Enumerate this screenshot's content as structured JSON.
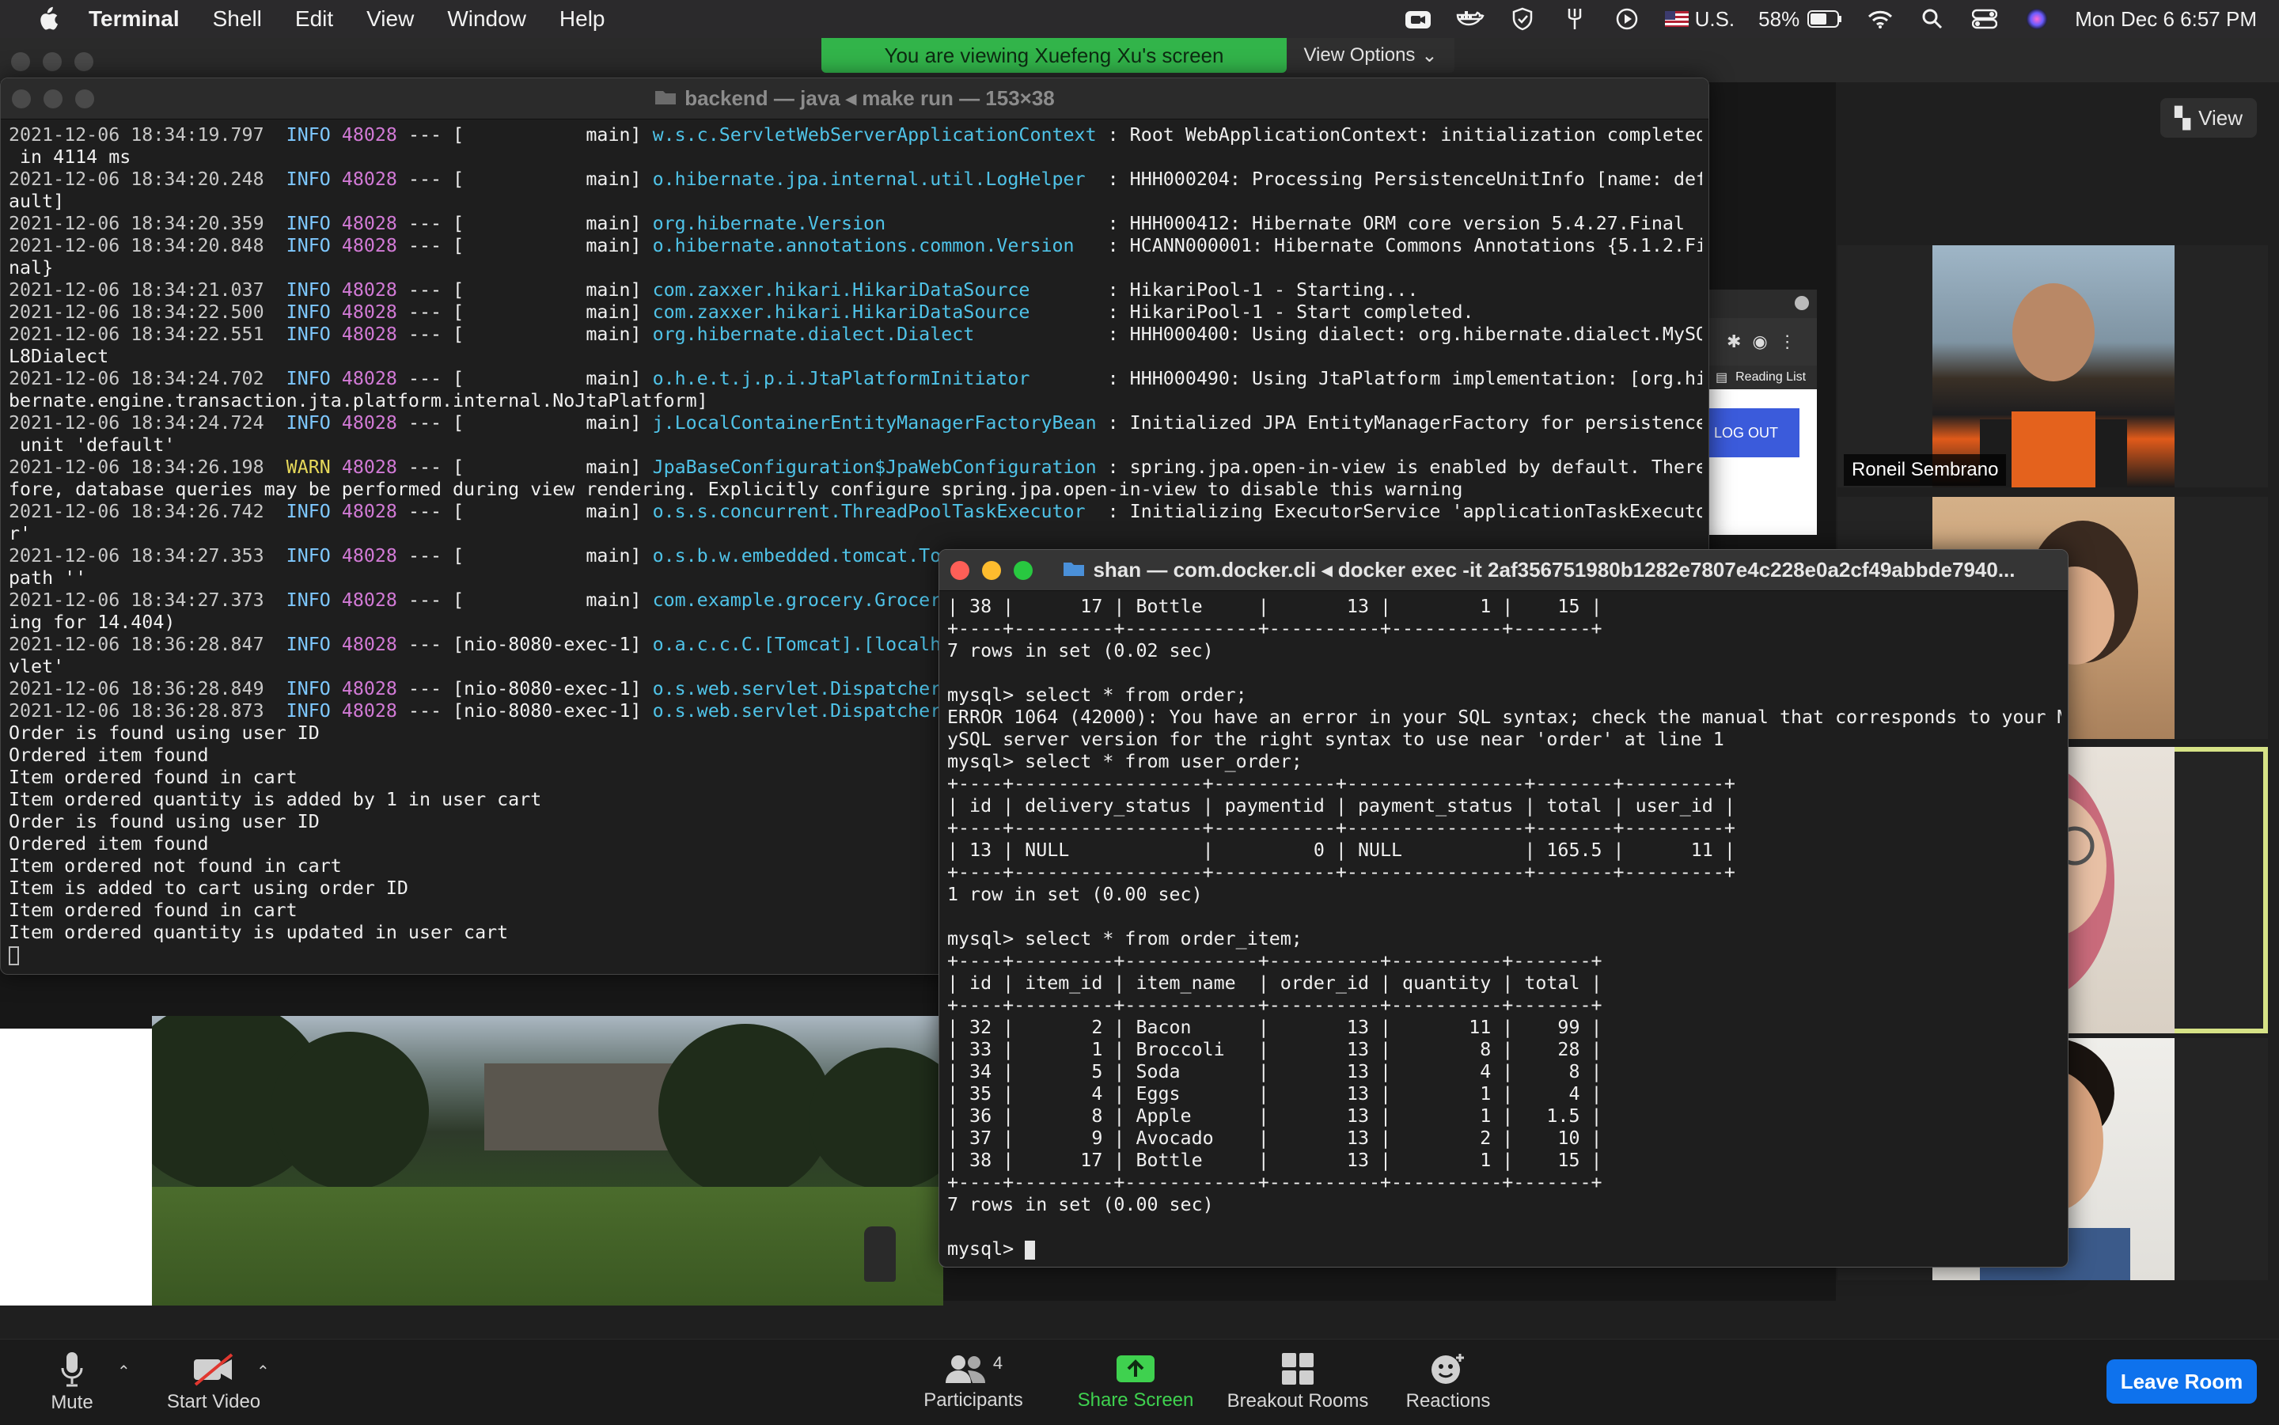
{
  "menubar": {
    "app_name": "Terminal",
    "menus": [
      "Shell",
      "Edit",
      "View",
      "Window",
      "Help"
    ],
    "input_source": "U.S.",
    "battery": "58%",
    "datetime": "Mon Dec 6  6:57 PM"
  },
  "zoom": {
    "banner": "You are viewing Xuefeng Xu's screen",
    "view_options": "View Options",
    "view_label": "View",
    "participants": [
      {
        "name": "Roneil Sembrano"
      },
      {
        "name": ""
      },
      {
        "name": ""
      },
      {
        "name": ""
      }
    ],
    "toolbar": {
      "mute": "Mute",
      "start_video": "Start Video",
      "participants": "Participants",
      "participants_count": "4",
      "share_screen": "Share Screen",
      "breakout_rooms": "Breakout Rooms",
      "reactions": "Reactions",
      "leave_room": "Leave Room"
    },
    "browser_fragment": {
      "reading_list": "Reading List",
      "logout": "LOG OUT"
    }
  },
  "backend_terminal": {
    "title": "backend — java ◂ make run — 153×38",
    "lines": [
      "2021-12-06 18:34:19.797  INFO 48028 --- [           main] w.s.c.ServletWebServerApplicationContext : Root WebApplicationContext: initialization completed",
      " in 4114 ms",
      "2021-12-06 18:34:20.248  INFO 48028 --- [           main] o.hibernate.jpa.internal.util.LogHelper  : HHH000204: Processing PersistenceUnitInfo [name: def",
      "ault]",
      "2021-12-06 18:34:20.359  INFO 48028 --- [           main] org.hibernate.Version                    : HHH000412: Hibernate ORM core version 5.4.27.Final",
      "2021-12-06 18:34:20.848  INFO 48028 --- [           main] o.hibernate.annotations.common.Version   : HCANN000001: Hibernate Commons Annotations {5.1.2.Fi",
      "nal}",
      "2021-12-06 18:34:21.037  INFO 48028 --- [           main] com.zaxxer.hikari.HikariDataSource       : HikariPool-1 - Starting...",
      "2021-12-06 18:34:22.500  INFO 48028 --- [           main] com.zaxxer.hikari.HikariDataSource       : HikariPool-1 - Start completed.",
      "2021-12-06 18:34:22.551  INFO 48028 --- [           main] org.hibernate.dialect.Dialect            : HHH000400: Using dialect: org.hibernate.dialect.MySQ",
      "L8Dialect",
      "2021-12-06 18:34:24.702  INFO 48028 --- [           main] o.h.e.t.j.p.i.JtaPlatformInitiator       : HHH000490: Using JtaPlatform implementation: [org.hi",
      "bernate.engine.transaction.jta.platform.internal.NoJtaPlatform]",
      "2021-12-06 18:34:24.724  INFO 48028 --- [           main] j.LocalContainerEntityManagerFactoryBean : Initialized JPA EntityManagerFactory for persistence",
      " unit 'default'",
      "2021-12-06 18:34:26.198  WARN 48028 --- [           main] JpaBaseConfiguration$JpaWebConfiguration : spring.jpa.open-in-view is enabled by default. There",
      "fore, database queries may be performed during view rendering. Explicitly configure spring.jpa.open-in-view to disable this warning",
      "2021-12-06 18:34:26.742  INFO 48028 --- [           main] o.s.s.concurrent.ThreadPoolTaskExecutor  : Initializing ExecutorService 'applicationTaskExecuto",
      "r'",
      "2021-12-06 18:34:27.353  INFO 48028 --- [           main] o.s.b.w.embedded.tomcat.To",
      "path ''",
      "2021-12-06 18:34:27.373  INFO 48028 --- [           main] com.example.grocery.Grocer",
      "ing for 14.404)",
      "2021-12-06 18:36:28.847  INFO 48028 --- [nio-8080-exec-1] o.a.c.c.C.[Tomcat].[localh",
      "vlet'",
      "2021-12-06 18:36:28.849  INFO 48028 --- [nio-8080-exec-1] o.s.web.servlet.Dispatcher",
      "2021-12-06 18:36:28.873  INFO 48028 --- [nio-8080-exec-1] o.s.web.servlet.Dispatcher",
      "Order is found using user ID",
      "Ordered item found",
      "Item ordered found in cart",
      "Item ordered quantity is added by 1 in user cart",
      "Order is found using user ID",
      "Ordered item found",
      "Item ordered not found in cart",
      "Item is added to cart using order ID",
      "Item ordered found in cart",
      "Item ordered quantity is updated in user cart"
    ]
  },
  "docker_terminal": {
    "title": "shan — com.docker.cli ◂ docker exec -it 2af356751980b1282e7807e4c228e0a2cf49abbde7940...",
    "lines": [
      "| 38 |      17 | Bottle     |       13 |        1 |    15 |",
      "+----+---------+------------+----------+----------+-------+",
      "7 rows in set (0.02 sec)",
      "",
      "mysql> select * from order;",
      "ERROR 1064 (42000): You have an error in your SQL syntax; check the manual that corresponds to your M",
      "ySQL server version for the right syntax to use near 'order' at line 1",
      "mysql> select * from user_order;",
      "+----+-----------------+-----------+----------------+-------+---------+",
      "| id | delivery_status | paymentid | payment_status | total | user_id |",
      "+----+-----------------+-----------+----------------+-------+---------+",
      "| 13 | NULL            |         0 | NULL           | 165.5 |      11 |",
      "+----+-----------------+-----------+----------------+-------+---------+",
      "1 row in set (0.00 sec)",
      "",
      "mysql> select * from order_item;",
      "+----+---------+------------+----------+----------+-------+",
      "| id | item_id | item_name  | order_id | quantity | total |",
      "+----+---------+------------+----------+----------+-------+",
      "| 32 |       2 | Bacon      |       13 |       11 |    99 |",
      "| 33 |       1 | Broccoli   |       13 |        8 |    28 |",
      "| 34 |       5 | Soda       |       13 |        4 |     8 |",
      "| 35 |       4 | Eggs       |       13 |        1 |     4 |",
      "| 36 |       8 | Apple      |       13 |        1 |   1.5 |",
      "| 37 |       9 | Avocado    |       13 |        2 |    10 |",
      "| 38 |      17 | Bottle     |       13 |        1 |    15 |",
      "+----+---------+------------+----------+----------+-------+",
      "7 rows in set (0.00 sec)",
      "",
      "mysql> "
    ]
  }
}
